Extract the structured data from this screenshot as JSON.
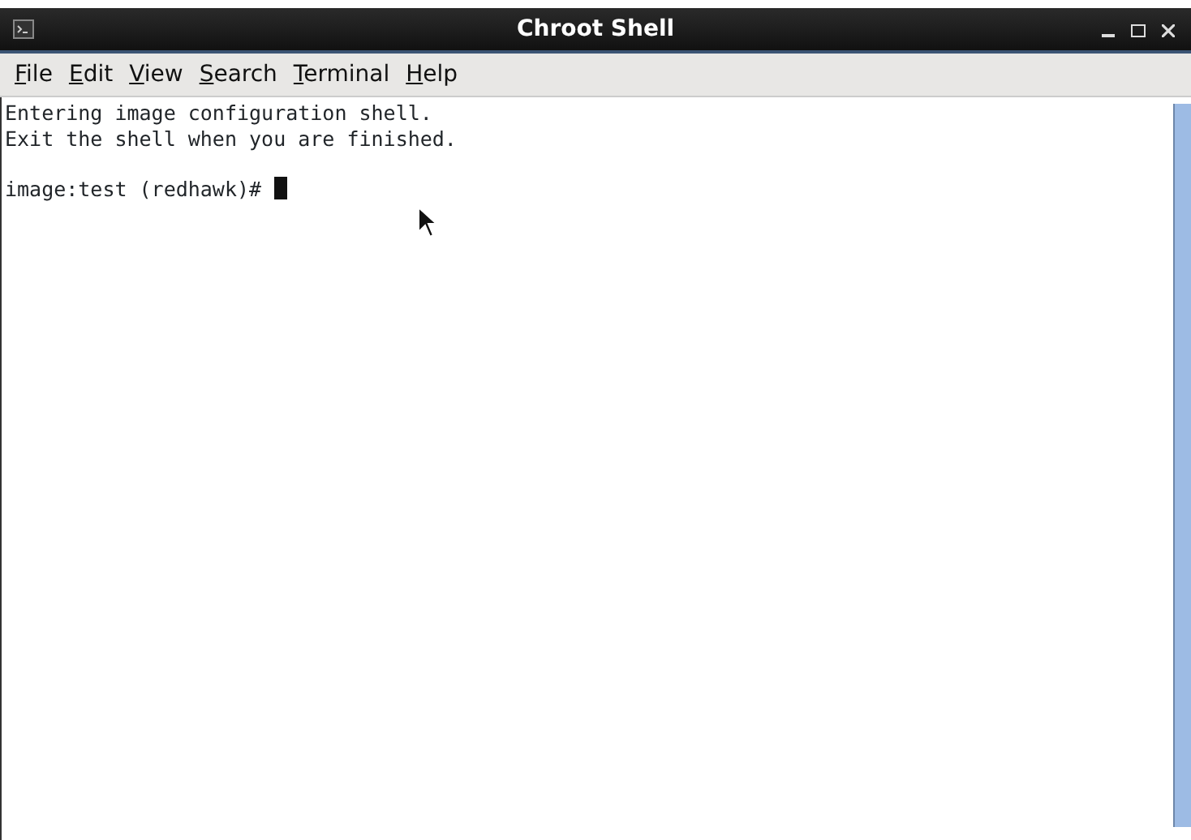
{
  "window": {
    "title": "Chroot Shell"
  },
  "menu": [
    "File",
    "Edit",
    "View",
    "Search",
    "Terminal",
    "Help"
  ],
  "terminal": {
    "output": [
      "Entering image configuration shell.",
      "Exit the shell when you are finished."
    ],
    "prompt": "image:test (redhawk)# "
  }
}
